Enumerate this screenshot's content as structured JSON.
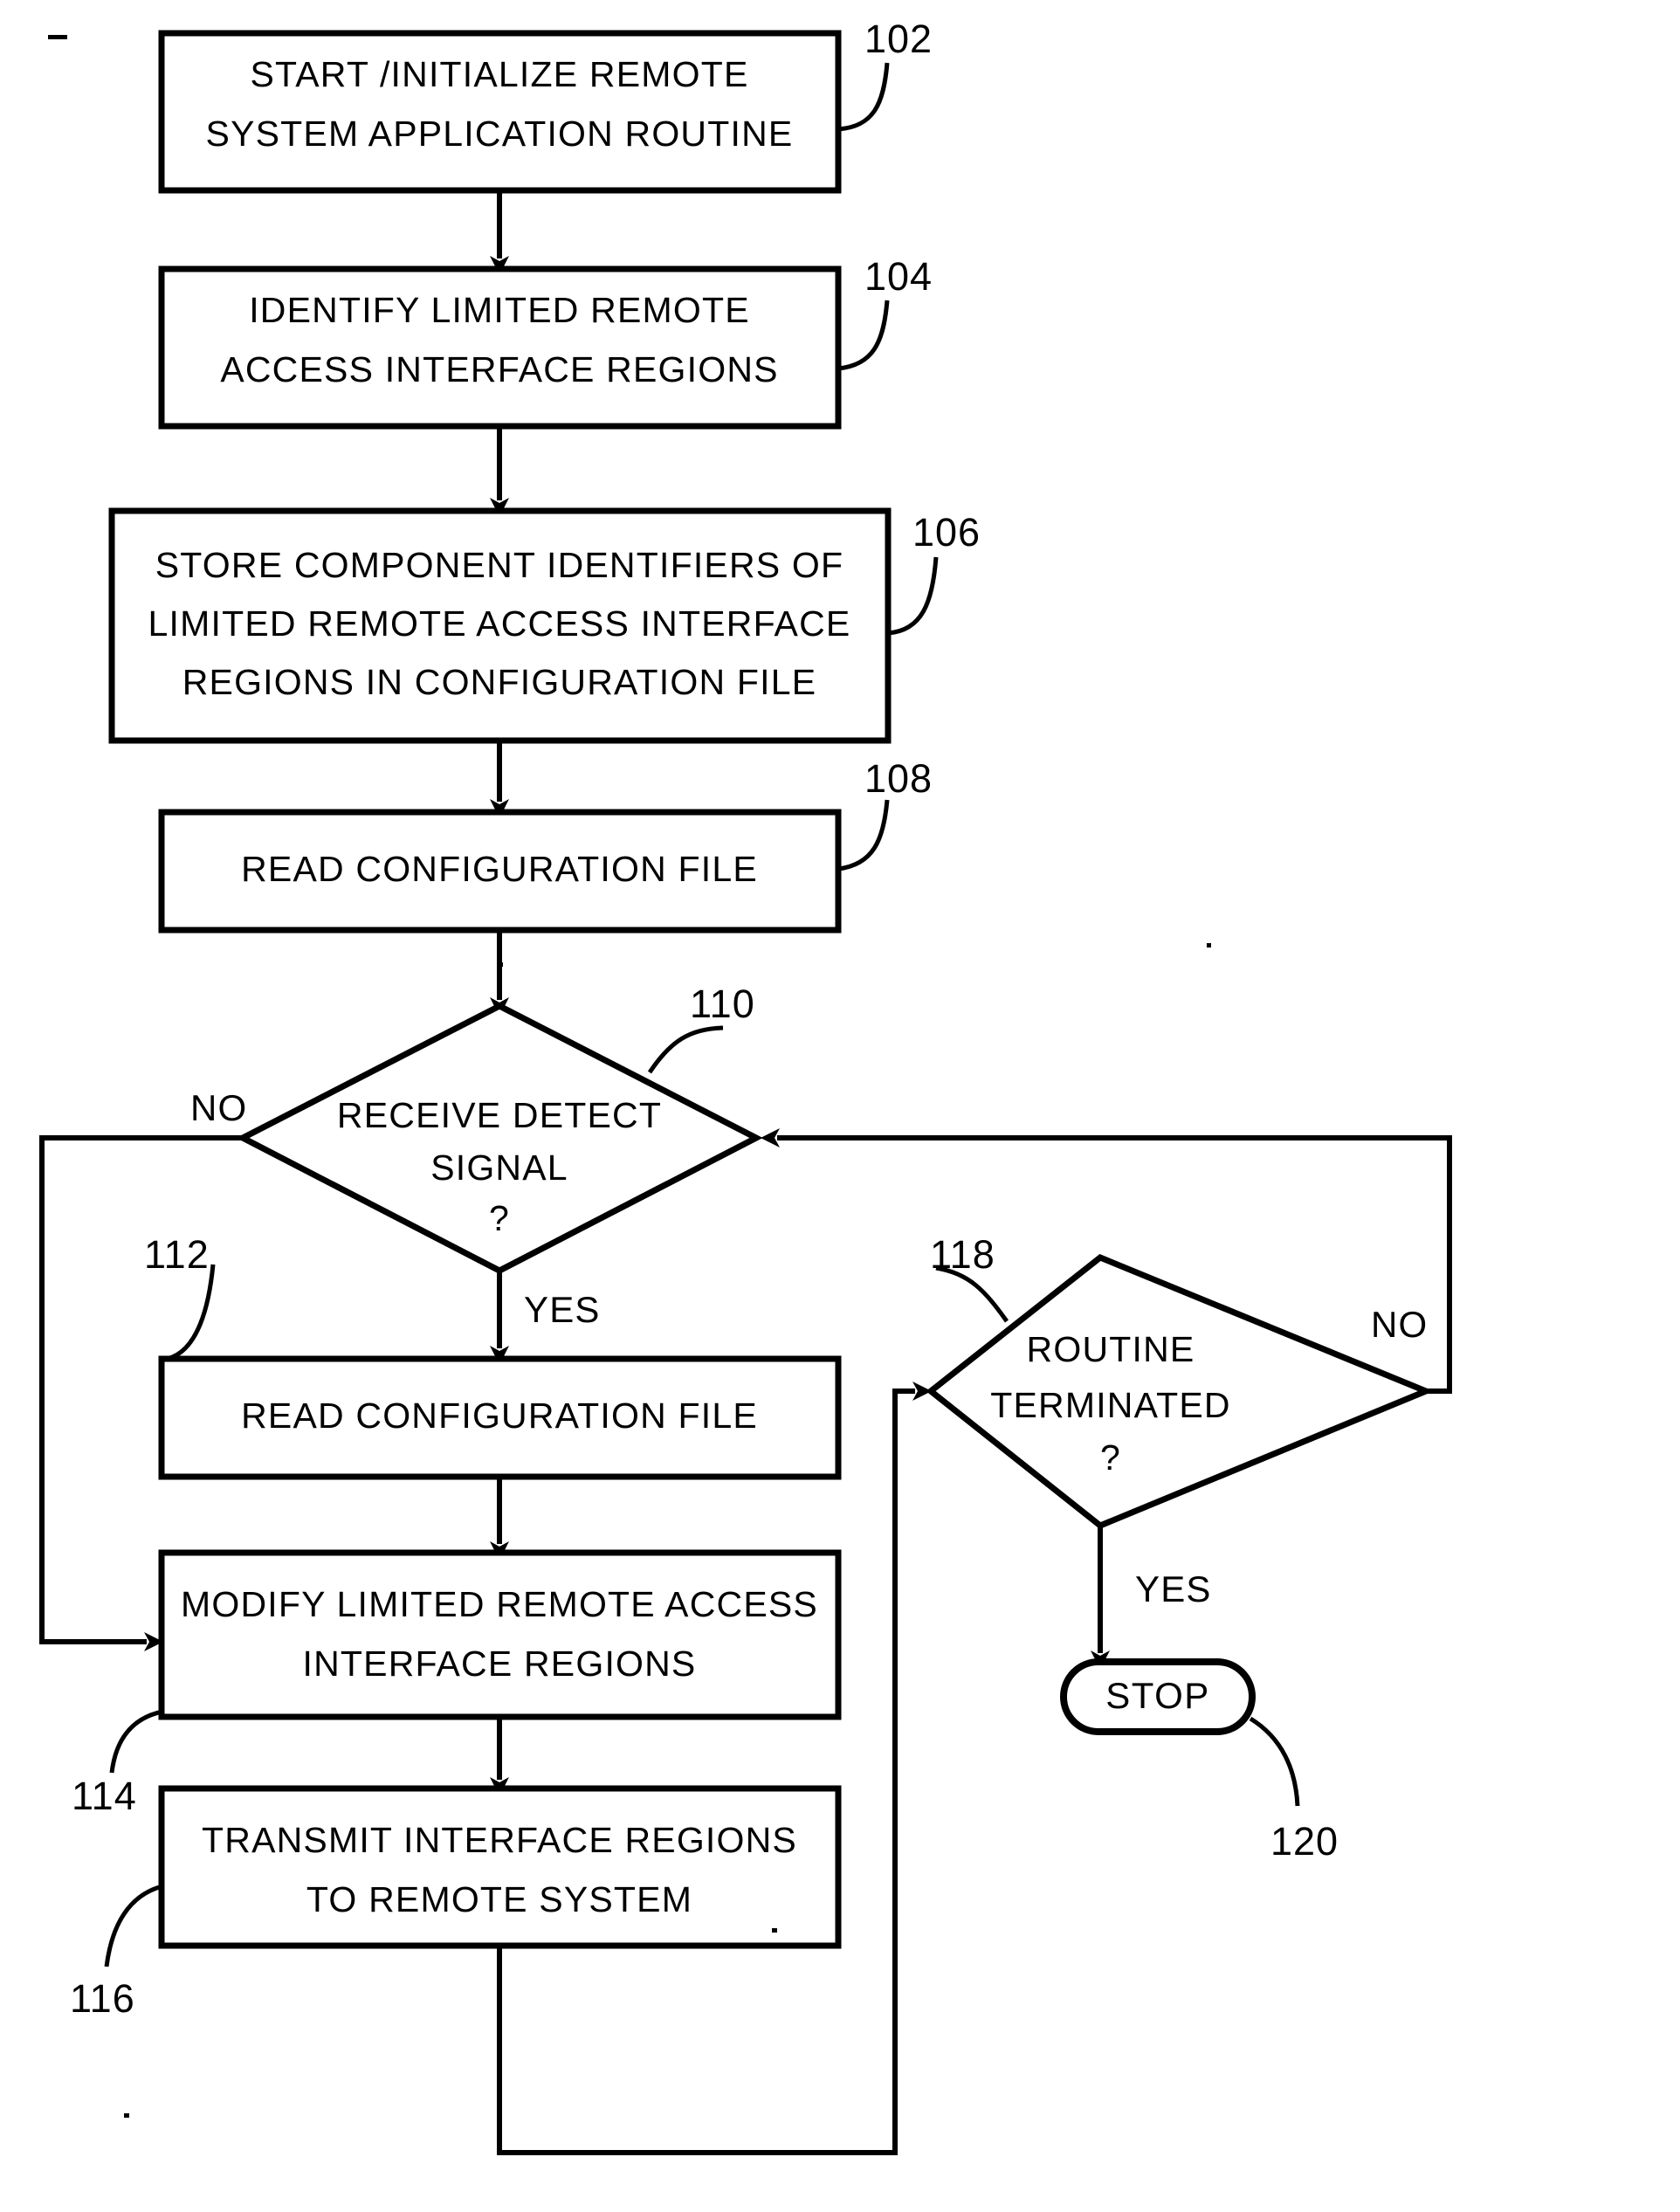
{
  "figure": {
    "type": "patent-flowchart",
    "background_color": "#ffffff",
    "line_color": "#000000"
  },
  "nodes": {
    "start": {
      "ref": "102",
      "shape": "rectangle",
      "line1": "START /INITIALIZE REMOTE",
      "line2": "SYSTEM  APPLICATION  ROUTINE"
    },
    "identify": {
      "ref": "104",
      "shape": "rectangle",
      "line1": "IDENTIFY LIMITED  REMOTE",
      "line2": "ACCESS  INTERFACE  REGIONS"
    },
    "store": {
      "ref": "106",
      "shape": "rectangle",
      "line1": "STORE COMPONENT  IDENTIFIERS  OF",
      "line2": "LIMITED  REMOTE ACCESS INTERFACE",
      "line3": "REGIONS IN  CONFIGURATION  FILE"
    },
    "read_config_1": {
      "ref": "108",
      "shape": "rectangle",
      "line1": "READ  CONFIGURATION  FILE"
    },
    "receive_detect": {
      "ref": "110",
      "shape": "diamond",
      "line1": "RECEIVE  DETECT",
      "line2": "SIGNAL",
      "line3": "?"
    },
    "read_config_2": {
      "ref": "112",
      "shape": "rectangle",
      "line1": "READ  CONFIGURATION  FILE"
    },
    "modify": {
      "ref": "114",
      "shape": "rectangle",
      "line1": "MODIFY LIMITED  REMOTE ACCESS",
      "line2": "INTERFACE  REGIONS"
    },
    "transmit": {
      "ref": "116",
      "shape": "rectangle",
      "line1": "TRANSMIT INTERFACE REGIONS",
      "line2": "TO  REMOTE  SYSTEM"
    },
    "routine_terminated": {
      "ref": "118",
      "shape": "diamond",
      "line1": "ROUTINE",
      "line2": "TERMINATED",
      "line3": "?"
    },
    "stop": {
      "ref": "120",
      "shape": "rounded-terminal",
      "line1": "STOP"
    }
  },
  "branch_labels": {
    "detect_no": "NO",
    "detect_yes": "YES",
    "terminated_no": "NO",
    "terminated_yes": "YES"
  },
  "ref_numbers": {
    "n102": "102",
    "n104": "104",
    "n106": "106",
    "n108": "108",
    "n110": "110",
    "n112": "112",
    "n114": "114",
    "n116": "116",
    "n118": "118",
    "n120": "120"
  }
}
